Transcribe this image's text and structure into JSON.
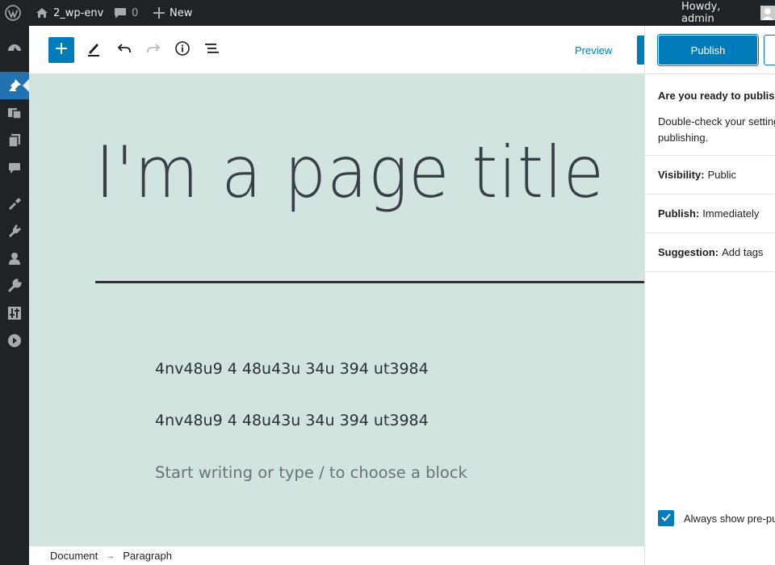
{
  "admin_bar": {
    "site_name": "2_wp-env",
    "comment_count": "0",
    "new_label": "New",
    "greeting": "Howdy, admin"
  },
  "admin_menu": {
    "items": [
      "dashboard-icon",
      "posts-icon",
      "media-icon",
      "pages-icon",
      "comments-icon",
      "appearance-icon",
      "plugins-icon",
      "users-icon",
      "tools-icon",
      "settings-icon",
      "collapse-icon"
    ],
    "active": "posts-icon"
  },
  "header": {
    "preview_label": "Preview"
  },
  "canvas": {
    "title": "I'm a page title",
    "paragraphs": [
      "4nv48u9 4 48u43u 34u 394 ut3984",
      "4nv48u9 4 48u43u 34u 394 ut3984"
    ],
    "placeholder": "Start writing or type / to choose a block",
    "background_color": "#d2e4e0"
  },
  "footer": {
    "breadcrumb": [
      "Document",
      "Paragraph"
    ],
    "separator": "→"
  },
  "prepublish": {
    "publish_label": "Publish",
    "ready_title": "Are you ready to publish?",
    "ready_desc": "Double-check your settings before publishing.",
    "visibility_label": "Visibility:",
    "visibility_value": "Public",
    "publish_label_row": "Publish:",
    "publish_value": "Immediately",
    "suggestion_label": "Suggestion:",
    "suggestion_value": "Add tags",
    "always_show_label": "Always show pre-publish checks.",
    "always_show_checked": true
  },
  "colors": {
    "accent": "#007cba",
    "admin_dark": "#1d2327",
    "admin_active": "#2271b1"
  }
}
